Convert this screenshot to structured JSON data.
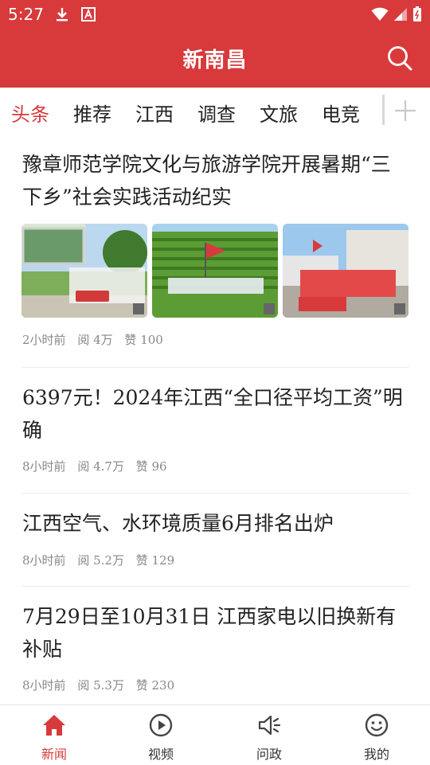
{
  "status_bar": {
    "time": "5:27"
  },
  "app_bar": {
    "title": "新南昌"
  },
  "tabs": [
    {
      "label": "头条",
      "active": true
    },
    {
      "label": "推荐"
    },
    {
      "label": "江西"
    },
    {
      "label": "调查"
    },
    {
      "label": "文旅"
    },
    {
      "label": "电竞"
    }
  ],
  "articles": [
    {
      "title": "豫章师范学院文化与旅游学院开展暑期“三下乡”社会实践活动纪实",
      "time": "2小时前",
      "reads": "阅 4万",
      "likes": "赞 100"
    },
    {
      "title": "6397元！2024年江西“全口径平均工资”明确",
      "time": "8小时前",
      "reads": "阅 4.7万",
      "likes": "赞 96"
    },
    {
      "title": "江西空气、水环境质量6月排名出炉",
      "time": "8小时前",
      "reads": "阅 5.2万",
      "likes": "赞 129"
    },
    {
      "title": "7月29日至10月31日 江西家电以旧换新有补贴",
      "time": "8小时前",
      "reads": "阅 5.3万",
      "likes": "赞 230"
    }
  ],
  "bottom_nav": [
    {
      "label": "新闻",
      "icon": "home-icon",
      "active": true
    },
    {
      "label": "视频",
      "icon": "play-icon"
    },
    {
      "label": "问政",
      "icon": "megaphone-icon"
    },
    {
      "label": "我的",
      "icon": "smiley-icon"
    }
  ],
  "colors": {
    "brand_red": "#d83a3c"
  }
}
